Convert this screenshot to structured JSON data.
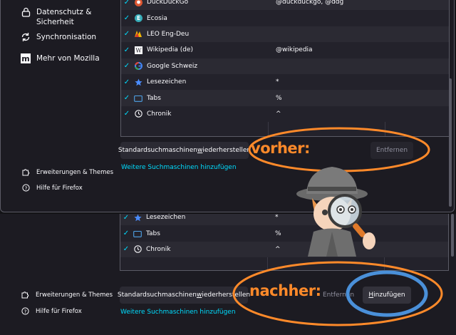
{
  "sidebar_top": {
    "items": [
      {
        "label": "Datenschutz & Sicherheit",
        "icon": "lock-icon"
      },
      {
        "label": "Synchronisation",
        "icon": "sync-icon"
      },
      {
        "label": "Mehr von Mozilla",
        "icon": "mozilla-icon"
      }
    ],
    "footer": [
      {
        "label": "Erweiterungen & Themes",
        "icon": "puzzle-icon"
      },
      {
        "label": "Hilfe für Firefox",
        "icon": "help-icon"
      }
    ]
  },
  "engines_before": [
    {
      "name": "DuckDuckGo",
      "keyword": "@duckduckgo, @ddg",
      "icon": "duckduckgo-icon"
    },
    {
      "name": "Ecosia",
      "keyword": "",
      "icon": "ecosia-icon"
    },
    {
      "name": "LEO Eng-Deu",
      "keyword": "",
      "icon": "leo-icon"
    },
    {
      "name": "Wikipedia (de)",
      "keyword": "@wikipedia",
      "icon": "wikipedia-icon"
    },
    {
      "name": "Google Schweiz",
      "keyword": "",
      "icon": "google-icon"
    },
    {
      "name": "Lesezeichen",
      "keyword": "*",
      "icon": "star-icon"
    },
    {
      "name": "Tabs",
      "keyword": "%",
      "icon": "tab-icon"
    },
    {
      "name": "Chronik",
      "keyword": "^",
      "icon": "clock-icon"
    }
  ],
  "engines_after": [
    {
      "name": "Lesezeichen",
      "keyword": "*",
      "icon": "star-icon"
    },
    {
      "name": "Tabs",
      "keyword": "%",
      "icon": "tab-icon"
    },
    {
      "name": "Chronik",
      "keyword": "^",
      "icon": "clock-icon"
    }
  ],
  "buttons": {
    "restore_prefix": "Standardsuchmaschinen ",
    "restore_underlined": "w",
    "restore_suffix": "iederherstellen",
    "remove": "Entfernen",
    "add_prefix": "",
    "add_underlined": "H",
    "add_suffix": "inzufügen"
  },
  "links": {
    "more_engines": "Weitere Suchmaschinen hinzufügen"
  },
  "annotations": {
    "before": "vorher:",
    "after": "nachher:"
  },
  "colors": {
    "accent": "#00ddff",
    "annotation_orange": "#ff8a2a",
    "annotation_blue": "#4a90d9",
    "background": "#1c1b22"
  }
}
